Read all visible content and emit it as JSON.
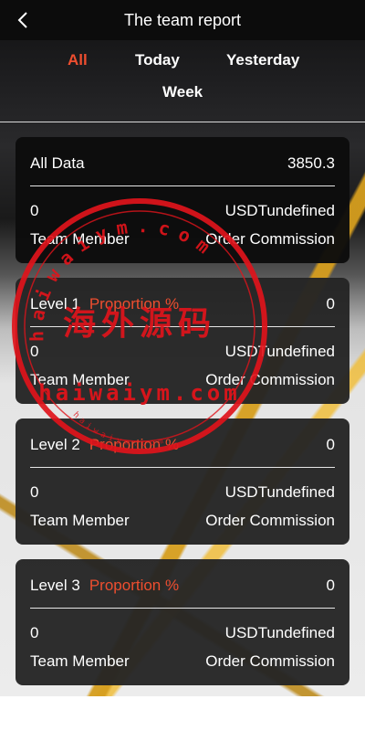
{
  "header": {
    "title": "The team report",
    "back_icon": "chevron-left-icon"
  },
  "tabs": [
    {
      "label": "All",
      "active": true
    },
    {
      "label": "Today",
      "active": false
    },
    {
      "label": "Yesterday",
      "active": false
    },
    {
      "label": "Week",
      "active": false
    }
  ],
  "colors": {
    "accent": "#ee4e2f",
    "header_bg": "#0c0c0c",
    "card_bg": "#242424",
    "stamp": "#e0141b"
  },
  "summary": {
    "label": "All Data",
    "total": "3850.3",
    "members_value": "0",
    "commission_value": "USDTundefined",
    "members_label": "Team Member",
    "commission_label": "Order Commission"
  },
  "levels": [
    {
      "label": "Level 1",
      "proportion_label": "Proportion %",
      "value": "0",
      "members_value": "0",
      "commission_value": "USDTundefined",
      "members_label": "Team Member",
      "commission_label": "Order Commission"
    },
    {
      "label": "Level 2",
      "proportion_label": "Proportion %",
      "value": "0",
      "members_value": "0",
      "commission_value": "USDTundefined",
      "members_label": "Team Member",
      "commission_label": "Order Commission"
    },
    {
      "label": "Level 3",
      "proportion_label": "Proportion %",
      "value": "0",
      "members_value": "0",
      "commission_value": "USDTundefined",
      "members_label": "Team Member",
      "commission_label": "Order Commission"
    }
  ],
  "watermark": {
    "outer_text": "haiwaiym.com",
    "chinese_text": "海外源码",
    "middle_text": "haiwaiym.com",
    "bottom_text": "haiwaiym.com"
  }
}
